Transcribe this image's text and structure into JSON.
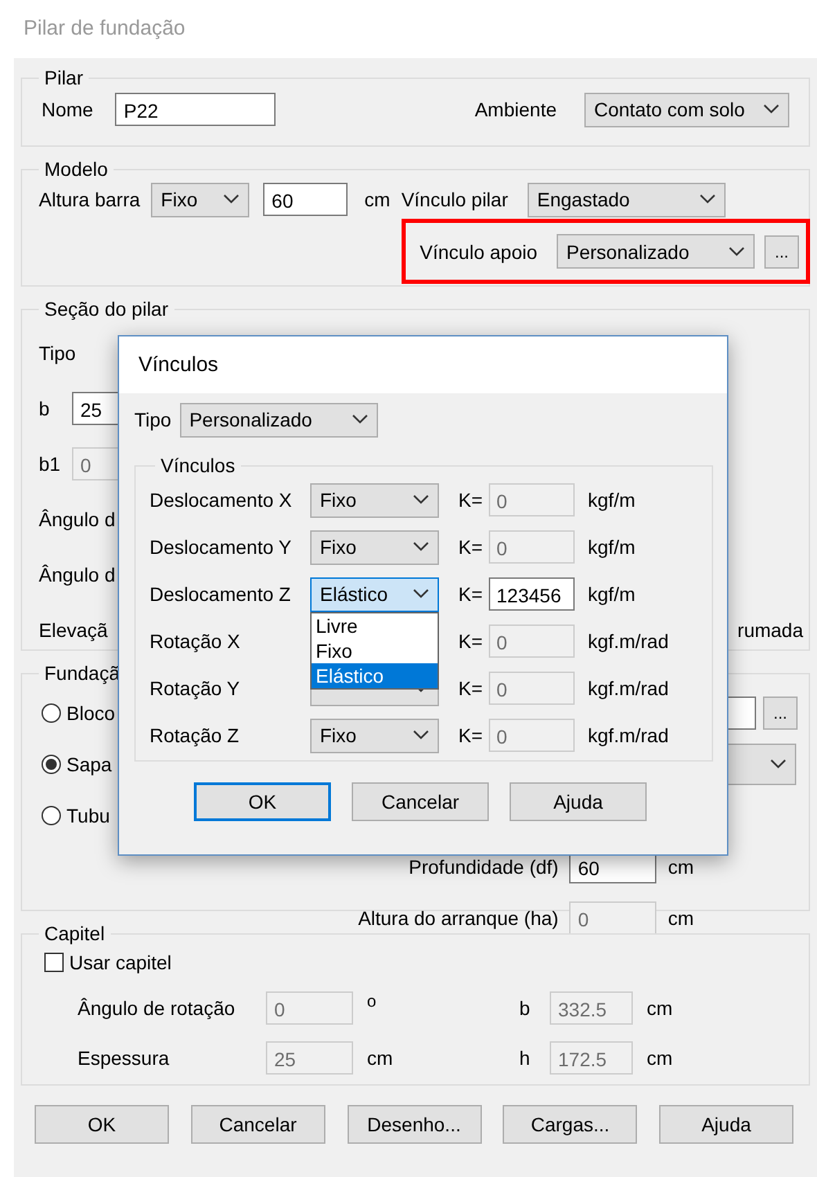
{
  "window": {
    "title": "Pilar de fundação"
  },
  "pilar": {
    "legend": "Pilar",
    "nome_label": "Nome",
    "nome_value": "P22",
    "ambiente_label": "Ambiente",
    "ambiente_value": "Contato com solo"
  },
  "modelo": {
    "legend": "Modelo",
    "altura_label": "Altura barra",
    "altura_mode": "Fixo",
    "altura_value": "60",
    "altura_unit": "cm",
    "vinculo_pilar_label": "Vínculo pilar",
    "vinculo_pilar_value": "Engastado",
    "vinculo_apoio_label": "Vínculo apoio",
    "vinculo_apoio_value": "Personalizado",
    "more_button": "...",
    "highlighted": true
  },
  "secao": {
    "legend": "Seção do pilar",
    "rows": [
      {
        "kind": "label",
        "label": "Tipo"
      },
      {
        "kind": "field",
        "label": "b",
        "value": "25",
        "disabled": false
      },
      {
        "kind": "field",
        "label": "b1",
        "value": "0",
        "disabled": true
      },
      {
        "kind": "label",
        "label": "Ângulo d"
      },
      {
        "kind": "label",
        "label": "Ângulo d"
      },
      {
        "kind": "label",
        "label": "Elevaçã",
        "right_text": "rumada"
      }
    ]
  },
  "fundacao": {
    "legend": "Fundaçã",
    "options": [
      {
        "label": "Bloco",
        "selected": false
      },
      {
        "label": "Sapa",
        "selected": true
      },
      {
        "label": "Tubu",
        "selected": false
      }
    ],
    "more_button": "...",
    "fields": [
      {
        "label": "Profundidade (df)",
        "value": "60",
        "unit": "cm",
        "disabled": false
      },
      {
        "label": "Altura do arranque (ha)",
        "value": "0",
        "unit": "cm",
        "disabled": true
      }
    ]
  },
  "capitel": {
    "legend": "Capitel",
    "use": {
      "label": "Usar capitel",
      "checked": false
    },
    "fields": [
      {
        "label": "Ângulo de rotação",
        "value": "0",
        "unit": "o",
        "disabled": true
      },
      {
        "label": "b",
        "value": "332.5",
        "unit": "cm",
        "disabled": true
      },
      {
        "label": "Espessura",
        "value": "25",
        "unit": "cm",
        "disabled": true
      },
      {
        "label": "h",
        "value": "172.5",
        "unit": "cm",
        "disabled": true
      }
    ]
  },
  "buttons": [
    {
      "label": "OK"
    },
    {
      "label": "Cancelar"
    },
    {
      "label": "Desenho..."
    },
    {
      "label": "Cargas..."
    },
    {
      "label": "Ajuda"
    }
  ],
  "vinculos_dialog": {
    "title": "Vínculos",
    "tipo_label": "Tipo",
    "tipo_value": "Personalizado",
    "legend": "Vínculos",
    "rows": [
      {
        "label": "Deslocamento X",
        "value": "Fixo",
        "k_label": "K=",
        "k_value": "0",
        "k_disabled": true,
        "unit": "kgf/m",
        "open": false
      },
      {
        "label": "Deslocamento Y",
        "value": "Fixo",
        "k_label": "K=",
        "k_value": "0",
        "k_disabled": true,
        "unit": "kgf/m",
        "open": false
      },
      {
        "label": "Deslocamento Z",
        "value": "Elástico",
        "k_label": "K=",
        "k_value": "123456",
        "k_disabled": false,
        "unit": "kgf/m",
        "open": true,
        "options": [
          {
            "label": "Livre",
            "selected": false
          },
          {
            "label": "Fixo",
            "selected": false
          },
          {
            "label": "Elástico",
            "selected": true
          }
        ]
      },
      {
        "label": "Rotação X",
        "k_label": "K=",
        "k_value": "0",
        "k_disabled": true,
        "unit": "kgf.m/rad"
      },
      {
        "label": "Rotação Y",
        "k_label": "K=",
        "k_value": "0",
        "k_disabled": true,
        "unit": "kgf.m/rad",
        "open": false
      },
      {
        "label": "Rotação Z",
        "value": "Fixo",
        "k_label": "K=",
        "k_value": "0",
        "k_disabled": true,
        "unit": "kgf.m/rad",
        "open": false
      }
    ],
    "buttons": [
      {
        "label": "OK",
        "focused": true
      },
      {
        "label": "Cancelar",
        "focused": false
      },
      {
        "label": "Ajuda",
        "focused": false
      }
    ]
  }
}
